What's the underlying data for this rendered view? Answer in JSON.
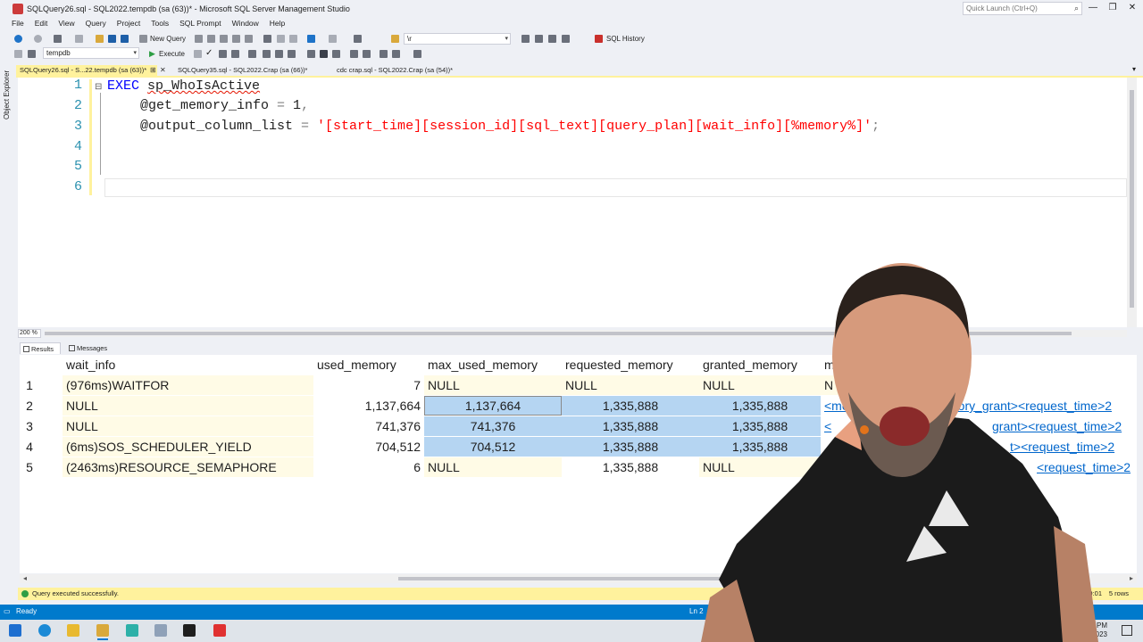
{
  "window": {
    "title": "SQLQuery26.sql - SQL2022.tempdb (sa (63))* - Microsoft SQL Server Management Studio",
    "quick_launch_placeholder": "Quick Launch (Ctrl+Q)"
  },
  "menu": [
    "File",
    "Edit",
    "View",
    "Query",
    "Project",
    "Tools",
    "SQL Prompt",
    "Window",
    "Help"
  ],
  "toolbar": {
    "new_query": "New Query",
    "search_value": "\\r",
    "sql_history": "SQL History",
    "database": "tempdb",
    "execute": "Execute"
  },
  "left_strip": {
    "label": "Object Explorer"
  },
  "tabs": [
    {
      "label": "SQLQuery26.sql - S...22.tempdb (sa (63))*",
      "active": true
    },
    {
      "label": "SQLQuery35.sql - SQL2022.Crap (sa (66))*",
      "active": false
    },
    {
      "label": "cdc crap.sql - SQL2022.Crap (sa (54))*",
      "active": false
    }
  ],
  "editor": {
    "line_numbers": [
      "1",
      "2",
      "3",
      "4",
      "5",
      "6"
    ],
    "line1": {
      "kw": "EXEC",
      "proc": "sp_WhoIsActive"
    },
    "line2": {
      "param": "@get_memory_info",
      "op": " = ",
      "value": "1",
      "comma": ","
    },
    "line3": {
      "param": "@output_column_list",
      "op": " = ",
      "value": "'[start_time][session_id][sql_text][query_plan][wait_info][%memory%]'",
      "end": ";"
    },
    "zoom": "200 %"
  },
  "results_tabs": [
    "Results",
    "Messages"
  ],
  "grid": {
    "headers": [
      "wait_info",
      "used_memory",
      "max_used_memory",
      "requested_memory",
      "granted_memory",
      "m"
    ],
    "rows": [
      {
        "num": "1",
        "wait_info": "(976ms)WAITFOR",
        "used_memory": "7",
        "max_used_memory": "NULL",
        "requested_memory": "NULL",
        "granted_memory": "NULL",
        "memory_info": "N"
      },
      {
        "num": "2",
        "wait_info": "NULL",
        "used_memory": "1,137,664",
        "max_used_memory": "1,137,664",
        "requested_memory": "1,335,888",
        "granted_memory": "1,335,888",
        "memory_info": "<me",
        "memory_info_tail": "mory_grant><request_time>2"
      },
      {
        "num": "3",
        "wait_info": "NULL",
        "used_memory": "741,376",
        "max_used_memory": "741,376",
        "requested_memory": "1,335,888",
        "granted_memory": "1,335,888",
        "memory_info": "<",
        "memory_info_tail": "grant><request_time>2"
      },
      {
        "num": "4",
        "wait_info": "(6ms)SOS_SCHEDULER_YIELD",
        "used_memory": "704,512",
        "max_used_memory": "704,512",
        "requested_memory": "1,335,888",
        "granted_memory": "1,335,888",
        "memory_info": "",
        "memory_info_tail": "t><request_time>2"
      },
      {
        "num": "5",
        "wait_info": "(2463ms)RESOURCE_SEMAPHORE",
        "used_memory": "6",
        "max_used_memory": "NULL",
        "requested_memory": "1,335,888",
        "granted_memory": "NULL",
        "memory_info": "",
        "memory_info_tail": "<request_time>2"
      }
    ]
  },
  "query_status": {
    "message": "Query executed successfully.",
    "elapsed": "00:00:01",
    "rows": "5 rows"
  },
  "status_bar": {
    "ready": "Ready",
    "line": "Ln 2"
  },
  "clock": {
    "time": "PM",
    "date": "/2023"
  }
}
